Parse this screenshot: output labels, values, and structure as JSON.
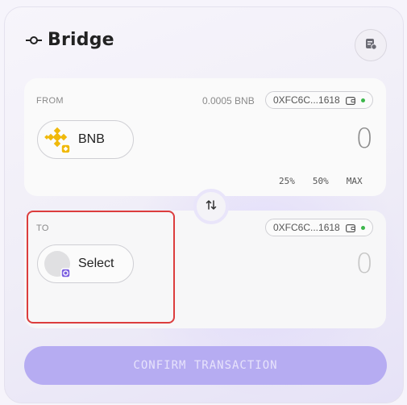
{
  "header": {
    "title": "Bridge",
    "icon": "bridge-icon",
    "history_icon": "history-icon"
  },
  "from": {
    "label": "FROM",
    "balance": "0.0005 BNB",
    "address": "0XFC6C...1618",
    "token": "BNB",
    "amount": "0",
    "percent_options": [
      "25%",
      "50%",
      "MAX"
    ],
    "colors": {
      "token": "#F0B90B"
    }
  },
  "to": {
    "label": "TO",
    "address": "0XFC6C...1618",
    "token": "Select",
    "amount": "0"
  },
  "confirm_label": "CONFIRM TRANSACTION",
  "colors": {
    "accent": "#B6ACF2",
    "highlight": "#DC3D3D",
    "connected": "#3CB64B"
  }
}
